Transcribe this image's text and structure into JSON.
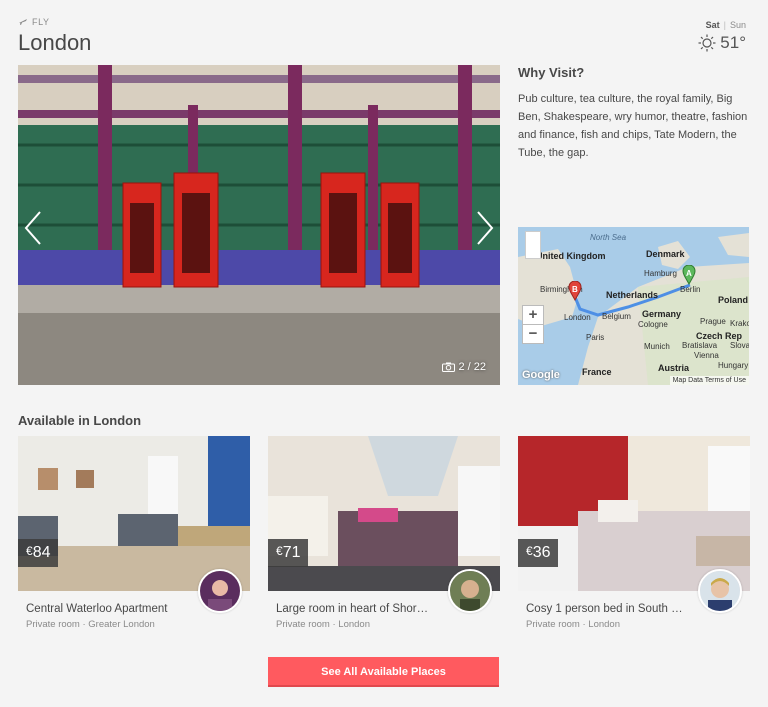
{
  "header": {
    "mode": "FLY",
    "city": "London",
    "weather": {
      "day_active": "Sat",
      "day_other": "Sun",
      "temp": "51°"
    }
  },
  "gallery": {
    "counter": "2 / 22"
  },
  "why": {
    "title": "Why Visit?",
    "body": "Pub culture, tea culture, the royal family, Big Ben, Shakespeare, wry humor, theatre, fashion and finance, fish and chips, Tate Modern, the Tube, the gap."
  },
  "map": {
    "labels": [
      "North Sea",
      "United Kingdom",
      "Denmark",
      "Hamburg",
      "Birmingham",
      "Netherlands",
      "Berlin",
      "Poland",
      "London",
      "Belgium",
      "Germany",
      "Cologne",
      "Prague",
      "Krako",
      "Paris",
      "Munich",
      "Czech Rep",
      "Vienna",
      "Bratislava",
      "Slova",
      "France",
      "Austria",
      "Hungary"
    ],
    "marker_a": "A",
    "marker_b": "B",
    "footer": "Map Data   Terms of Use",
    "logo": "Google"
  },
  "available": {
    "title": "Available in London",
    "listings": [
      {
        "price": "84",
        "currency": "€",
        "name": "Central Waterloo Apartment",
        "meta": "Private room · Greater London"
      },
      {
        "price": "71",
        "currency": "€",
        "name": "Large room in heart of Shor…",
        "meta": "Private room · London"
      },
      {
        "price": "36",
        "currency": "€",
        "name": "Cosy 1 person bed in South …",
        "meta": "Private room · London"
      }
    ]
  },
  "cta": {
    "label": "See All Available Places"
  },
  "colors": {
    "accent": "#ff5a5f",
    "text": "#484848",
    "muted": "#8a8a8a"
  },
  "icons": [
    "plane-icon",
    "sun-icon",
    "chevron-left-icon",
    "chevron-right-icon",
    "camera-icon",
    "zoom-in-icon",
    "zoom-out-icon",
    "pegman-icon",
    "map-marker-icon"
  ]
}
